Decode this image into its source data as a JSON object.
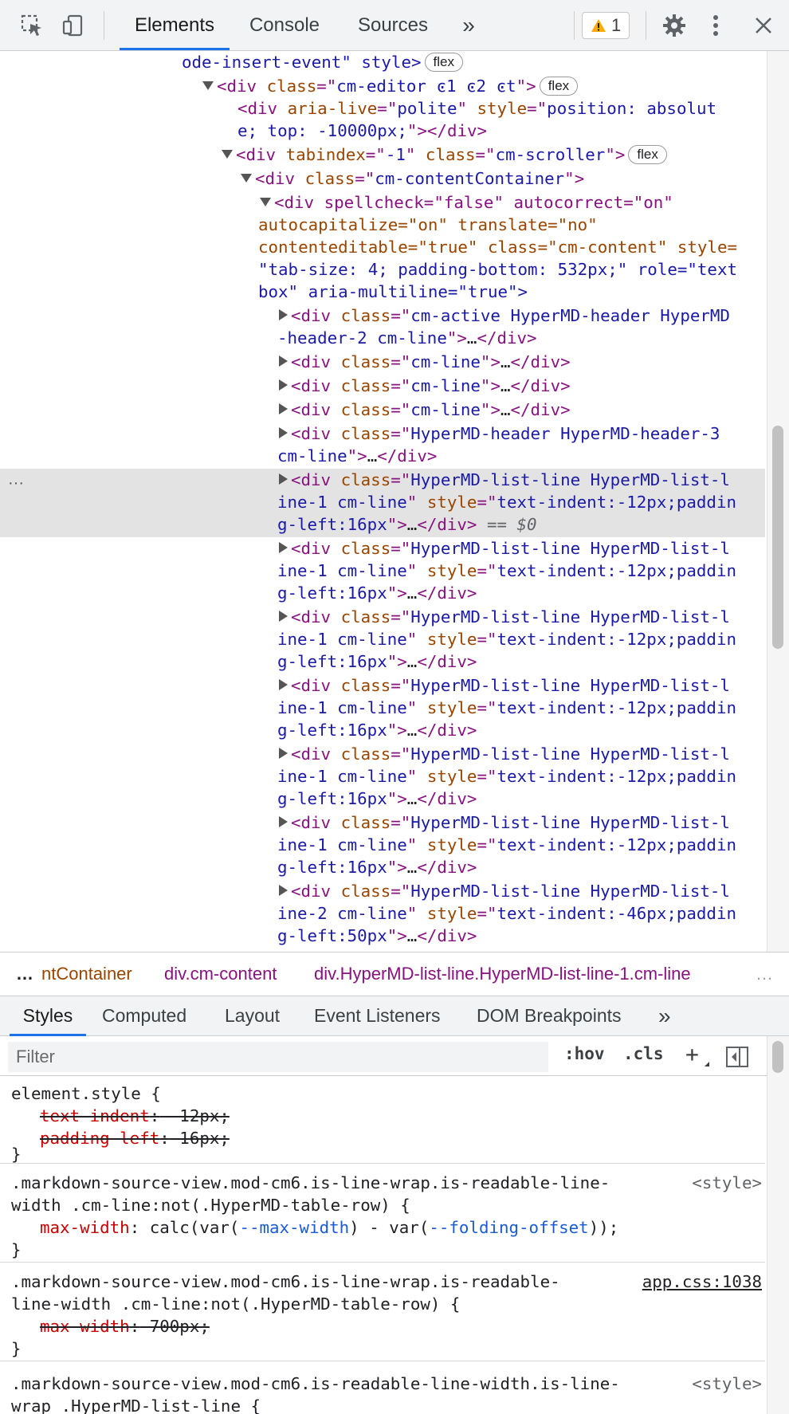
{
  "toolbar": {
    "tabs": [
      "Elements",
      "Console",
      "Sources"
    ],
    "more": "»",
    "warning_count": "1"
  },
  "tree": {
    "l1": "ode-insert-event\" style>",
    "l2_cls": "cm-editor ͼ1 ͼ2 ͼt",
    "l3_style": "position: absolut",
    "l3b": "e; top: -10000px;",
    "l4_cls": "cm-scroller",
    "l5_cls": "cm-contentContainer",
    "l6a": "<div spellcheck=\"false\" autocorrect=\"on\"",
    "l6b": "autocapitalize=\"on\" translate=\"no\"",
    "l6c": "contenteditable=\"true\" class=\"cm-content\" style=",
    "l6d": "\"tab-size: 4; padding-bottom: 532px;\" role=\"text",
    "l6e": "box\" aria-multiline=\"true\">",
    "child1a": "cm-active HyperMD-header HyperMD",
    "child1b": "-header-2 cm-line",
    "cmline": "cm-line",
    "hdr3a": "HyperMD-header HyperMD-header-3",
    "hdr3b": "cm-line",
    "li_a": "HyperMD-list-line HyperMD-list-l",
    "li1_b": "ine-1 cm-line",
    "li1_style": "text-indent:-12px;paddin",
    "li1_c": "g-left:16px",
    "li2_b": "ine-2 cm-line",
    "li2_style": "text-indent:-46px;paddin",
    "li2_c": "g-left:50px",
    "flex": "flex",
    "selected_marker": "== $0",
    "ellipsis": "…"
  },
  "breadcrumbs": [
    "…",
    "ntContainer",
    "div.cm-content",
    "div.HyperMD-list-line.HyperMD-list-line-1.cm-line",
    "…"
  ],
  "styles_tabs": [
    "Styles",
    "Computed",
    "Layout",
    "Event Listeners",
    "DOM Breakpoints",
    "»"
  ],
  "filter": {
    "placeholder": "Filter",
    "hov": ":hov",
    "cls": ".cls",
    "plus": "+"
  },
  "rules": {
    "r1_sel": "element.style {",
    "r1_p1": "text-indent",
    "r1_v1": " -12px;",
    "r1_p2": "padding-left",
    "r1_v2": " 16px;",
    "close": "}",
    "r2_sel1": ".markdown-source-view.mod-cm6.is-line-wrap.is-readable-line-",
    "r2_sel2": "width .cm-line:not(.HyperMD-table-row) {",
    "r2_src": "<style>",
    "r2_p": "max-width",
    "r2_v_pre": " calc(var(",
    "r2_var1": "--max-width",
    "r2_v_mid": ") - var(",
    "r2_var2": "--folding-offset",
    "r2_v_post": "));",
    "r3_sel1": ".markdown-source-view.mod-cm6.is-line-wrap.is-readable-",
    "r3_sel2": "line-width .cm-line:not(.HyperMD-table-row) {",
    "r3_src": "app.css:1038",
    "r3_p": "max-width",
    "r3_v": " 700px;",
    "r4_sel1": ".markdown-source-view.mod-cm6.is-readable-line-width.is-line-",
    "r4_sel2": "wrap .HyperMD-list-line {",
    "r4_src": "<style>"
  }
}
